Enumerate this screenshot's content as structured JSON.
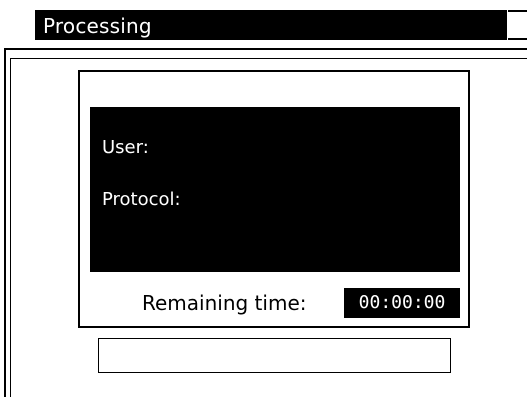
{
  "window": {
    "title": "Processing"
  },
  "dialog": {
    "user_label": "User:",
    "protocol_label": "Protocol:",
    "remaining_label": "Remaining time:",
    "remaining_value": "00:00:00"
  },
  "colors": {
    "background": "#ffffff",
    "foreground": "#000000",
    "panel": "#000000",
    "panel_text": "#ffffff"
  }
}
